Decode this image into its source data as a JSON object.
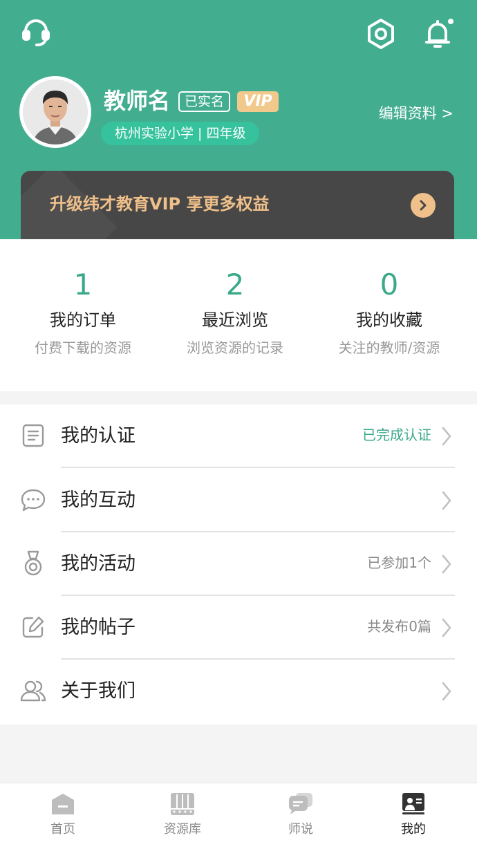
{
  "header": {
    "icons": {
      "support": "headset-icon",
      "settings": "settings-icon",
      "notifications": "bell-icon"
    },
    "username": "教师名",
    "verified_badge": "已实名",
    "vip_badge": "VIP",
    "school": "杭州实验小学 | 四年级",
    "edit_profile": "编辑资料 >",
    "vip_banner": "升级纬才教育VIP 享更多权益"
  },
  "stats": [
    {
      "value": "1",
      "title": "我的订单",
      "sub": "付费下载的资源"
    },
    {
      "value": "2",
      "title": "最近浏览",
      "sub": "浏览资源的记录"
    },
    {
      "value": "0",
      "title": "我的收藏",
      "sub": "关注的教师/资源"
    }
  ],
  "menu": [
    {
      "label": "我的认证",
      "status": "已完成认证",
      "icon": "document-list-icon"
    },
    {
      "label": "我的互动",
      "status": "",
      "icon": "chat-bubble-icon"
    },
    {
      "label": "我的活动",
      "status": "已参加1个",
      "icon": "medal-icon"
    },
    {
      "label": "我的帖子",
      "status": "共发布0篇",
      "icon": "edit-post-icon"
    },
    {
      "label": "关于我们",
      "status": "",
      "icon": "users-icon"
    }
  ],
  "tabs": [
    {
      "label": "首页",
      "icon": "home-icon",
      "active": false
    },
    {
      "label": "资源库",
      "icon": "library-icon",
      "active": false
    },
    {
      "label": "师说",
      "icon": "discussion-icon",
      "active": false
    },
    {
      "label": "我的",
      "icon": "profile-icon",
      "active": true
    }
  ],
  "colors": {
    "primary": "#43ad8f",
    "accent_gold": "#f0c08a",
    "stat_number": "#3aa98a"
  }
}
